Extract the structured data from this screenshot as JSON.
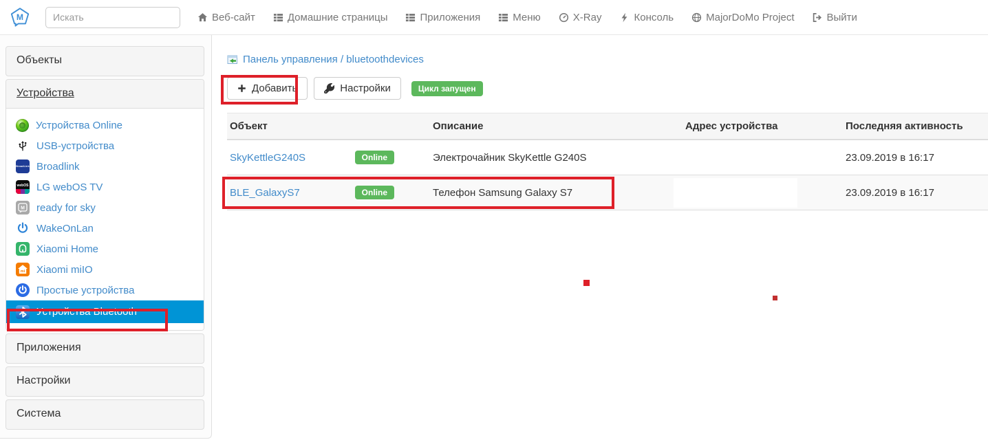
{
  "navbar": {
    "logo_letter": "M",
    "search_placeholder": "Искать",
    "items": [
      {
        "label": "Веб-сайт",
        "icon": "home-icon"
      },
      {
        "label": "Домашние страницы",
        "icon": "list-icon"
      },
      {
        "label": "Приложения",
        "icon": "list-icon"
      },
      {
        "label": "Меню",
        "icon": "list-icon"
      },
      {
        "label": "X-Ray",
        "icon": "gauge-icon"
      },
      {
        "label": "Консоль",
        "icon": "flash-icon"
      },
      {
        "label": "MajorDoMo Project",
        "icon": "globe-icon"
      },
      {
        "label": "Выйти",
        "icon": "logout-icon"
      }
    ]
  },
  "sidebar": {
    "sections": {
      "objects": "Объекты",
      "devices": "Устройства",
      "apps": "Приложения",
      "settings": "Настройки",
      "system": "Система"
    },
    "devices": [
      {
        "label": "Устройства Online",
        "icon": "online-led-icon"
      },
      {
        "label": "USB-устройства",
        "icon": "usb-icon"
      },
      {
        "label": "Broadlink",
        "icon": "broadlink-icon",
        "icon_text": "BroadLink"
      },
      {
        "label": "LG webOS TV",
        "icon": "webos-icon",
        "icon_text": "webOS"
      },
      {
        "label": "ready for sky",
        "icon": "ready-for-sky-icon",
        "icon_text": "M"
      },
      {
        "label": "WakeOnLan",
        "icon": "power-icon"
      },
      {
        "label": "Xiaomi Home",
        "icon": "xiaomi-home-icon"
      },
      {
        "label": "Xiaomi miIO",
        "icon": "xiaomi-miio-icon",
        "icon_text": "mi"
      },
      {
        "label": "Простые устройства",
        "icon": "power-circle-icon"
      },
      {
        "label": "Устройства Bluetooth",
        "icon": "bluetooth-icon",
        "active": true
      }
    ]
  },
  "main": {
    "breadcrumb": "Панель управления / bluetoothdevices",
    "toolbar": {
      "add_label": "Добавить",
      "settings_label": "Настройки",
      "cycle_badge": "Цикл запущен"
    },
    "table": {
      "columns": [
        "Объект",
        "Описание",
        "Адрес устройства",
        "Последняя активность"
      ],
      "rows": [
        {
          "object": "SkyKettleG240S",
          "status": "Online",
          "description": "Электрочайник SkyKettle G240S",
          "address": "",
          "last_activity": "23.09.2019 в 16:17"
        },
        {
          "object": "BLE_GalaxyS7",
          "status": "Online",
          "description": "Телефон Samsung Galaxy S7",
          "address": "",
          "last_activity": "23.09.2019 в 16:17",
          "highlighted": true
        }
      ]
    }
  },
  "colors": {
    "accent_blue": "#0094d6",
    "link_blue": "#428bca",
    "success_green": "#5cb85c",
    "annotation_red": "#de2029",
    "navbar_text": "#777777"
  }
}
